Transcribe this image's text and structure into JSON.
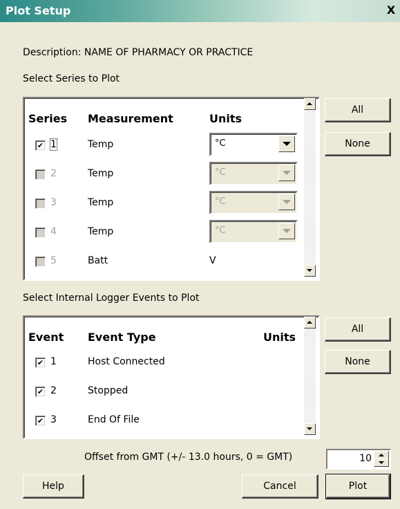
{
  "window": {
    "title": "Plot Setup",
    "close_glyph": "X"
  },
  "description": "Description: NAME OF PHARMACY OR PRACTICE",
  "series_section": {
    "label": "Select Series to Plot",
    "headers": {
      "series": "Series",
      "measurement": "Measurement",
      "units": "Units"
    },
    "rows": [
      {
        "num": "1",
        "checked": true,
        "enabled": true,
        "measurement": "Temp",
        "unit": "°C"
      },
      {
        "num": "2",
        "checked": false,
        "enabled": false,
        "measurement": "Temp",
        "unit": "°C"
      },
      {
        "num": "3",
        "checked": false,
        "enabled": false,
        "measurement": "Temp",
        "unit": "°C"
      },
      {
        "num": "4",
        "checked": false,
        "enabled": false,
        "measurement": "Temp",
        "unit": "°C"
      },
      {
        "num": "5",
        "checked": false,
        "enabled": false,
        "measurement": "Batt",
        "unit": "V"
      }
    ],
    "all_label": "All",
    "none_label": "None"
  },
  "events_section": {
    "label": "Select Internal Logger Events to Plot",
    "headers": {
      "event": "Event",
      "type": "Event Type",
      "units": "Units"
    },
    "rows": [
      {
        "num": "1",
        "checked": true,
        "type": "Host Connected"
      },
      {
        "num": "2",
        "checked": true,
        "type": "Stopped"
      },
      {
        "num": "3",
        "checked": true,
        "type": "End Of File"
      }
    ],
    "all_label": "All",
    "none_label": "None"
  },
  "offset": {
    "label": "Offset from GMT (+/- 13.0 hours, 0 = GMT)",
    "value": "10"
  },
  "buttons": {
    "help": "Help",
    "cancel": "Cancel",
    "plot": "Plot"
  },
  "check_glyph": "✔"
}
